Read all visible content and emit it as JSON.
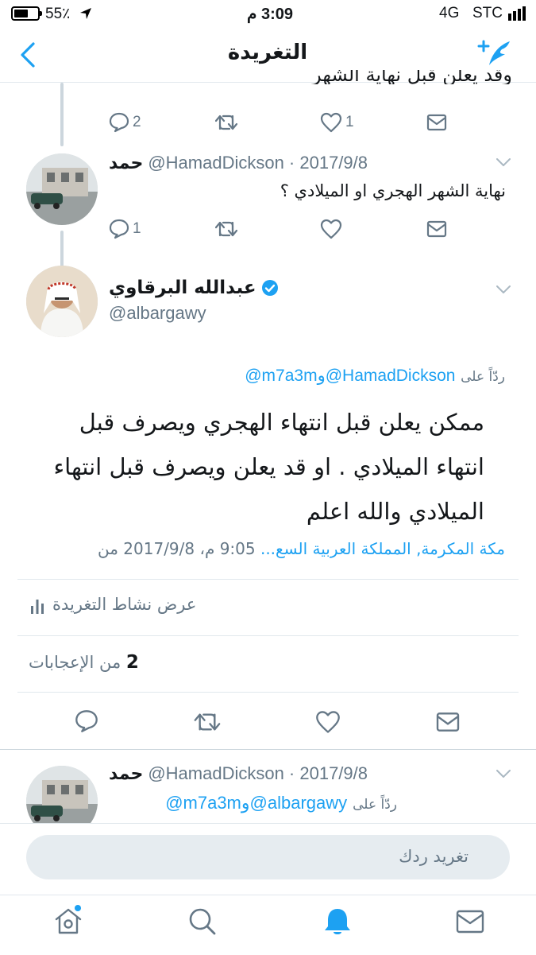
{
  "status_bar": {
    "battery": "55٪",
    "time": "3:09 م",
    "network": "4G",
    "carrier": "STC"
  },
  "header": {
    "title": "التغريدة"
  },
  "prev_tweet": {
    "text_fragment": "وقد يعلن قبل نهاية الشهر",
    "reply_count": "2",
    "like_count": "1"
  },
  "tweet_hamad_1": {
    "name": "حمد",
    "handle_date": "@HamadDickson · 2017/9/8",
    "text": "نهاية الشهر الهجري او الميلادي ؟",
    "reply_count": "1"
  },
  "main_tweet": {
    "name": "عبدالله البرقاوي",
    "handle": "@albargawy",
    "reply_prefix": "ردّاً على",
    "reply_to_1": "@HamadDickson",
    "reply_conj": "و",
    "reply_to_2": "@m7a3m",
    "line1": "ممكن يعلن قبل انتهاء الهجري ويصرف قبل",
    "line2": "انتهاء الميلادي . او قد يعلن ويصرف قبل انتهاء",
    "line3": "الميلادي والله اعلم",
    "time_meta": "9:05 م، 2017/9/8 من",
    "location": "مكة المكرمة, المملكة العربية السع...",
    "activity_label": "عرض نشاط التغريدة",
    "likes_count": "2",
    "likes_label": "من الإعجابات"
  },
  "tweet_hamad_2": {
    "name": "حمد",
    "handle_date": "@HamadDickson · 2017/9/8",
    "reply_prefix": "ردّاً على",
    "reply_to_1": "@albargawy",
    "reply_conj": "و",
    "reply_to_2": "@m7a3m"
  },
  "reply_bar": {
    "placeholder": "تغريد ردك"
  },
  "colors": {
    "accent": "#1da1f2",
    "verified": "#1da1f2",
    "icon_grey": "#657786"
  }
}
